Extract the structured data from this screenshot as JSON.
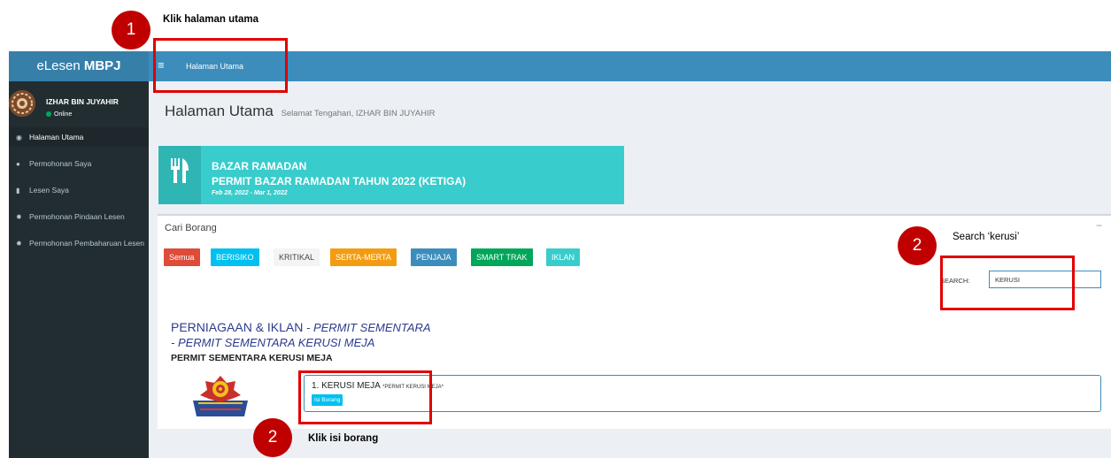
{
  "header": {
    "brand_light": "eLesen ",
    "brand_bold": "MBPJ",
    "menu_icon": "hamburger-icon",
    "nav_item": "Halaman Utama"
  },
  "sidebar": {
    "user_name": "IZHAR BIN JUYAHIR",
    "user_status": "Online",
    "items": [
      {
        "icon": "dashboard-icon",
        "label": "Halaman Utama"
      },
      {
        "icon": "users-icon",
        "label": "Permohonan Saya"
      },
      {
        "icon": "folder-icon",
        "label": "Lesen Saya"
      },
      {
        "icon": "gear-icon",
        "label": "Permohonan Pindaan Lesen"
      },
      {
        "icon": "gear-icon",
        "label": "Permohonan Pembaharuan Lesen"
      }
    ]
  },
  "page": {
    "title": "Halaman Utama",
    "greeting": "Selamat Tengahari, IZHAR BIN JUYAHIR"
  },
  "event": {
    "icon": "cutlery-icon",
    "title": "BAZAR RAMADAN",
    "subtitle": "PERMIT BAZAR RAMADAN TAHUN 2022 (KETIGA)",
    "date": "Feb 28, 2022 - Mar 1, 2022"
  },
  "form_box": {
    "title": "Cari Borang",
    "collapse": "−",
    "filters": [
      {
        "label": "Semua",
        "color": "#dd4b39"
      },
      {
        "label": "BERISIKO",
        "color": "#00c0ef"
      },
      {
        "label": "KRITIKAL",
        "color": "#f4f4f4"
      },
      {
        "label": "SERTA-MERTA",
        "color": "#f39c12"
      },
      {
        "label": "PENJAJA",
        "color": "#3c8dbc"
      },
      {
        "label": "SMART TRAK",
        "color": "#00a65a"
      },
      {
        "label": "IKLAN",
        "color": "#39cccc"
      }
    ],
    "search_label": "SEARCH:",
    "search_value": "KERUSI",
    "category": "PERNIAGAAN & IKLAN",
    "category_italic": " - PERMIT SEMENTARA",
    "category_sub": "- PERMIT SEMENTARA KERUSI MEJA",
    "category_bold": "PERMIT SEMENTARA KERUSI MEJA",
    "item_number": "1",
    "item_title": ". KERUSI MEJA ",
    "item_small": "*PERMIT KERUSI MEJA*",
    "item_button": "Isi Borang"
  },
  "annotations": {
    "step1_number": "1",
    "step1_text": "Klik halaman utama",
    "step2a_number": "2",
    "step2a_text": "Search ‘kerusi’",
    "step2b_number": "2",
    "step2b_text": "Klik isi borang"
  }
}
